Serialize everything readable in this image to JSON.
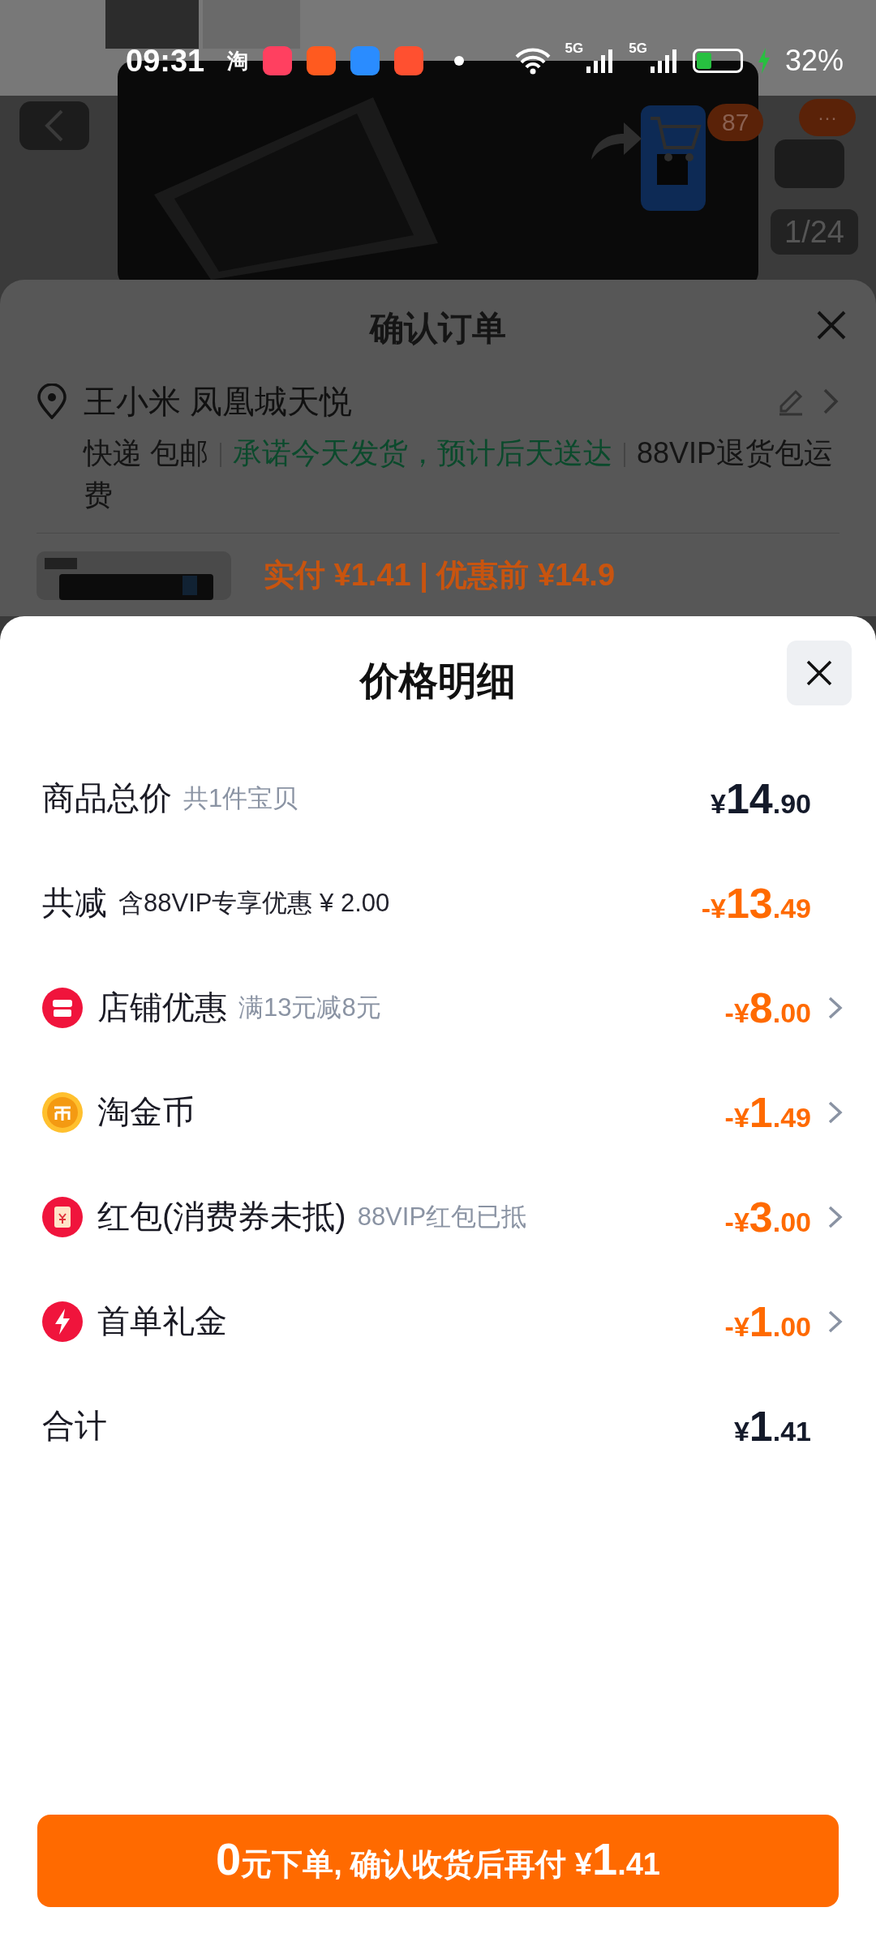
{
  "status_bar": {
    "time": "09:31",
    "app_letter": "淘",
    "network_labels": [
      "5G",
      "5G"
    ],
    "battery": "32%"
  },
  "product_page": {
    "cart_count": "87",
    "more_label": "···",
    "image_counter": "1/24"
  },
  "order_sheet": {
    "title": "确认订单",
    "recipient": "王小米 凤凰城天悦",
    "delivery": "快递 包邮",
    "promise": "承诺今天发货，预计后天送达",
    "perk": "88VIP退货包运费",
    "payment_line": "实付 ¥1.41 | 优惠前 ¥14.9"
  },
  "price_sheet": {
    "title": "价格明细",
    "rows": [
      {
        "kind": "plain",
        "label": "商品总价",
        "note": "共1件宝贝",
        "note_muted": true,
        "discount": false,
        "prefix": "¥",
        "whole": "14",
        "fraction": ".90",
        "arrow": false
      },
      {
        "kind": "plain",
        "label": "共减",
        "note": "含88VIP专享优惠 ¥ 2.00",
        "note_muted": false,
        "discount": true,
        "prefix": "-¥",
        "whole": "13",
        "fraction": ".49",
        "arrow": false
      },
      {
        "kind": "shop",
        "label": "店铺优惠",
        "note": "满13元减8元",
        "note_muted": true,
        "discount": true,
        "prefix": "-¥",
        "whole": "8",
        "fraction": ".00",
        "arrow": true
      },
      {
        "kind": "coin",
        "label": "淘金币",
        "discount": true,
        "prefix": "-¥",
        "whole": "1",
        "fraction": ".49",
        "arrow": true
      },
      {
        "kind": "red_packet",
        "label": "红包(消费券未抵)",
        "note": "88VIP红包已抵",
        "note_muted": true,
        "discount": true,
        "prefix": "-¥",
        "whole": "3",
        "fraction": ".00",
        "arrow": true
      },
      {
        "kind": "bolt",
        "label": "首单礼金",
        "discount": true,
        "prefix": "-¥",
        "whole": "1",
        "fraction": ".00",
        "arrow": true
      },
      {
        "kind": "plain",
        "label": "合计",
        "discount": false,
        "prefix": "¥",
        "whole": "1",
        "fraction": ".41",
        "arrow": false
      }
    ],
    "submit": [
      {
        "text": "0",
        "emphasis": true
      },
      {
        "text": "元下单, 确认收货后再付 ¥",
        "emphasis": false
      },
      {
        "text": "1",
        "emphasis": true
      },
      {
        "text": ".41",
        "emphasis": false
      }
    ]
  }
}
